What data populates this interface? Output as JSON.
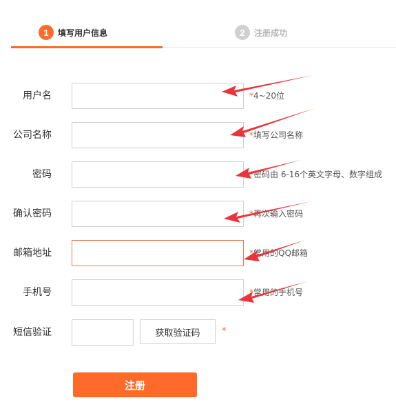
{
  "steps": [
    {
      "number": "1",
      "label": "填写用户信息"
    },
    {
      "number": "2",
      "label": "注册成功"
    }
  ],
  "form": {
    "fields": [
      {
        "label": "用户名",
        "value": "",
        "hint_star": "*",
        "hint": "4~20位"
      },
      {
        "label": "公司名称",
        "value": "",
        "hint_star": "*",
        "hint": "填写公司名称"
      },
      {
        "label": "密码",
        "value": "",
        "hint_star": "*",
        "hint": "密码由 6-16个英文字母、数字组成"
      },
      {
        "label": "确认密码",
        "value": "",
        "hint_star": "*",
        "hint": "再次输入密码"
      },
      {
        "label": "邮箱地址",
        "value": "",
        "hint_star": "*",
        "hint": "常用的QQ邮箱"
      },
      {
        "label": "手机号",
        "value": "",
        "hint_star": "*",
        "hint": "常用的手机号"
      }
    ],
    "sms": {
      "label": "短信验证",
      "value": "",
      "button_label": "获取验证码",
      "star": "*"
    },
    "submit_label": "注册"
  },
  "colors": {
    "accent": "#ff6a2a",
    "annotation_arrow": "#e8343a"
  }
}
